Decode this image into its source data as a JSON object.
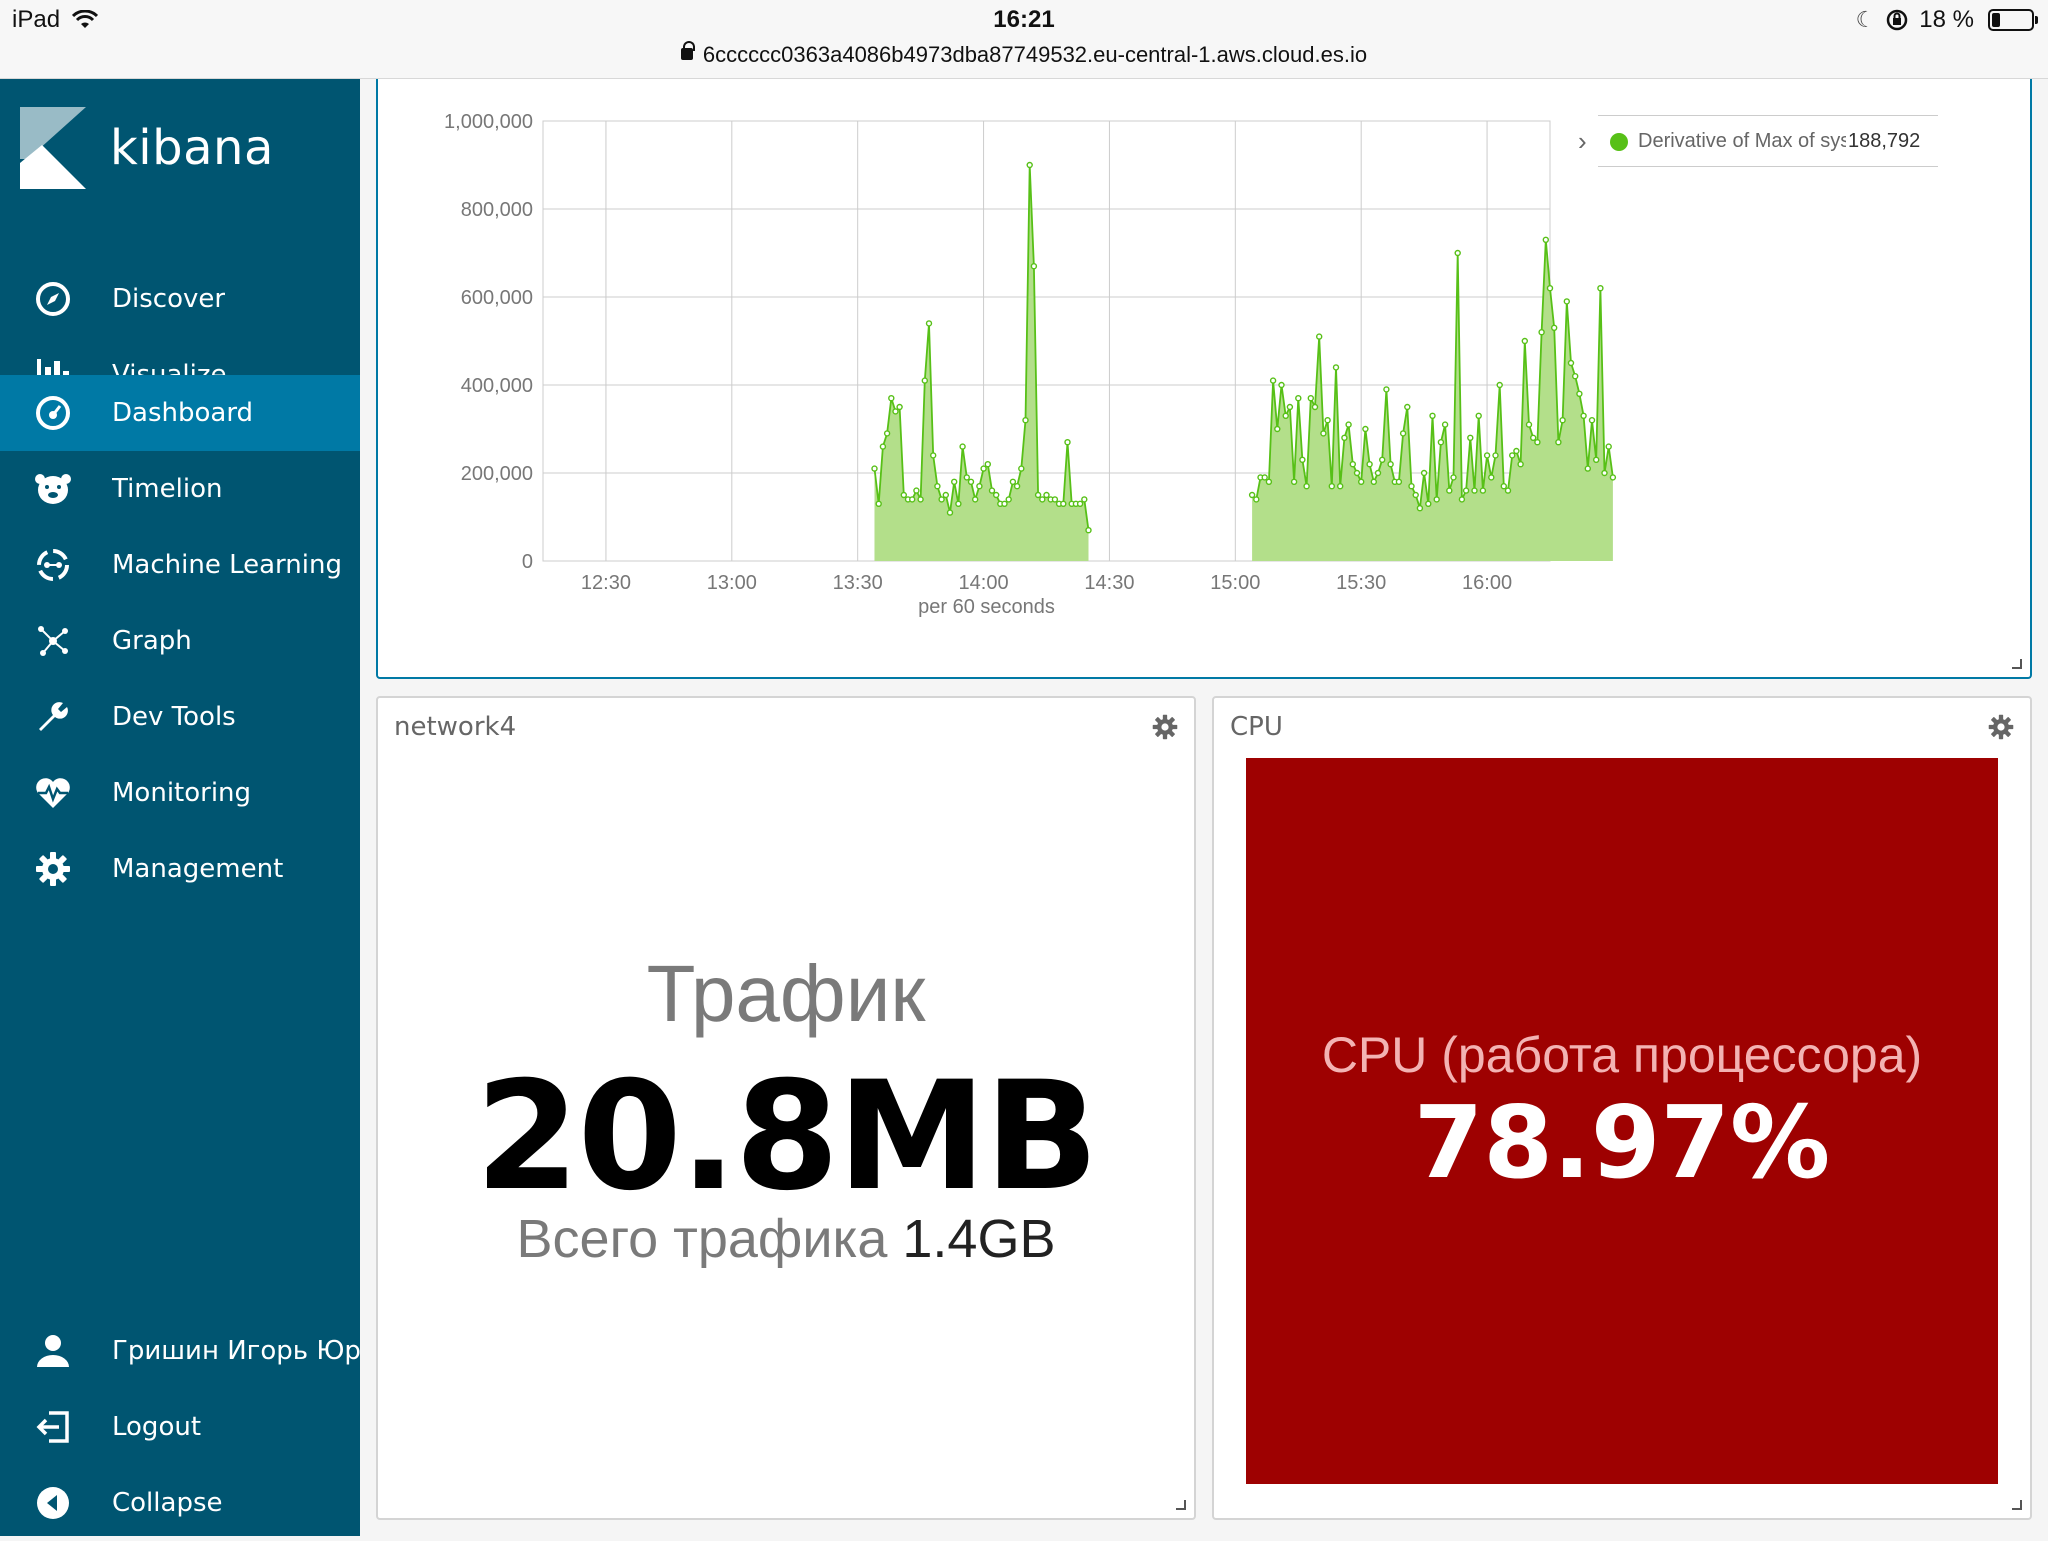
{
  "ios": {
    "device": "iPad",
    "time": "16:21",
    "battery": "18 %",
    "battery_level": 0.18,
    "url": "6cccccc0363a4086b4973dba87749532.eu-central-1.aws.cloud.es.io"
  },
  "sidebar": {
    "brand": "kibana",
    "items": [
      {
        "label": "Discover",
        "icon": "compass-icon"
      },
      {
        "label": "Visualize",
        "icon": "bar-chart-icon"
      },
      {
        "label": "Dashboard",
        "icon": "dashboard-icon",
        "active": true
      },
      {
        "label": "Timelion",
        "icon": "bear-icon"
      },
      {
        "label": "Machine Learning",
        "icon": "ml-icon"
      },
      {
        "label": "Graph",
        "icon": "graph-icon"
      },
      {
        "label": "Dev Tools",
        "icon": "wrench-icon"
      },
      {
        "label": "Monitoring",
        "icon": "heartbeat-icon"
      },
      {
        "label": "Management",
        "icon": "gear-icon"
      }
    ],
    "bottom_items": [
      {
        "label": "Гришин Игорь Юрьевич",
        "icon": "user-icon"
      },
      {
        "label": "Logout",
        "icon": "logout-icon"
      },
      {
        "label": "Collapse",
        "icon": "collapse-icon"
      }
    ]
  },
  "chart_data": {
    "type": "area",
    "xlabel": "per 60 seconds",
    "ylabel": "",
    "ylim": [
      0,
      1000000
    ],
    "y_ticks": [
      "1,000,000",
      "800,000",
      "600,000",
      "400,000",
      "200,000",
      "0"
    ],
    "x_ticks": [
      "12:30",
      "13:00",
      "13:30",
      "14:00",
      "14:30",
      "15:00",
      "15:30",
      "16:00"
    ],
    "legend": {
      "label": "Derivative of Max of system.network.in.bytes",
      "value": "188,792",
      "position": "top-right"
    },
    "series": [
      {
        "name": "Derivative of Max of system.network.in.bytes",
        "color": "#57c017",
        "segments": [
          {
            "start": "13:34",
            "values": [
              210000,
              130000,
              260000,
              290000,
              370000,
              340000,
              350000,
              150000,
              140000,
              140000,
              160000,
              140000,
              410000,
              540000,
              240000,
              170000,
              140000,
              150000,
              110000,
              180000,
              130000,
              260000,
              190000,
              180000,
              140000,
              170000,
              210000,
              220000,
              160000,
              150000,
              130000,
              130000,
              140000,
              180000,
              170000,
              210000,
              320000,
              900000,
              670000,
              150000,
              140000,
              150000,
              140000,
              140000,
              130000,
              130000,
              270000,
              130000,
              130000,
              130000,
              140000,
              70000
            ]
          },
          {
            "start": "15:04",
            "values": [
              150000,
              140000,
              190000,
              190000,
              180000,
              410000,
              300000,
              400000,
              330000,
              350000,
              180000,
              370000,
              230000,
              170000,
              370000,
              350000,
              510000,
              290000,
              320000,
              170000,
              440000,
              170000,
              280000,
              310000,
              220000,
              200000,
              180000,
              300000,
              220000,
              180000,
              200000,
              230000,
              390000,
              220000,
              180000,
              180000,
              290000,
              350000,
              170000,
              150000,
              120000,
              200000,
              130000,
              330000,
              140000,
              270000,
              310000,
              160000,
              190000,
              700000,
              140000,
              160000,
              280000,
              160000,
              330000,
              160000,
              240000,
              190000,
              240000,
              400000,
              170000,
              160000,
              240000,
              250000,
              220000,
              500000,
              310000,
              280000,
              270000,
              520000,
              730000,
              620000,
              530000,
              270000,
              320000,
              590000,
              450000,
              420000,
              380000,
              330000,
              210000,
              320000,
              230000,
              620000,
              200000,
              260000,
              190000
            ]
          }
        ]
      }
    ]
  },
  "network": {
    "title": "network4",
    "metric_label": "Трафик",
    "metric_value": "20.8MB",
    "total_label": "Всего трафика",
    "total_value": "1.4GB"
  },
  "cpu": {
    "title": "CPU",
    "metric_label": "CPU (работа процессора)",
    "metric_value": "78.97%",
    "bg_color": "#9e0101"
  }
}
